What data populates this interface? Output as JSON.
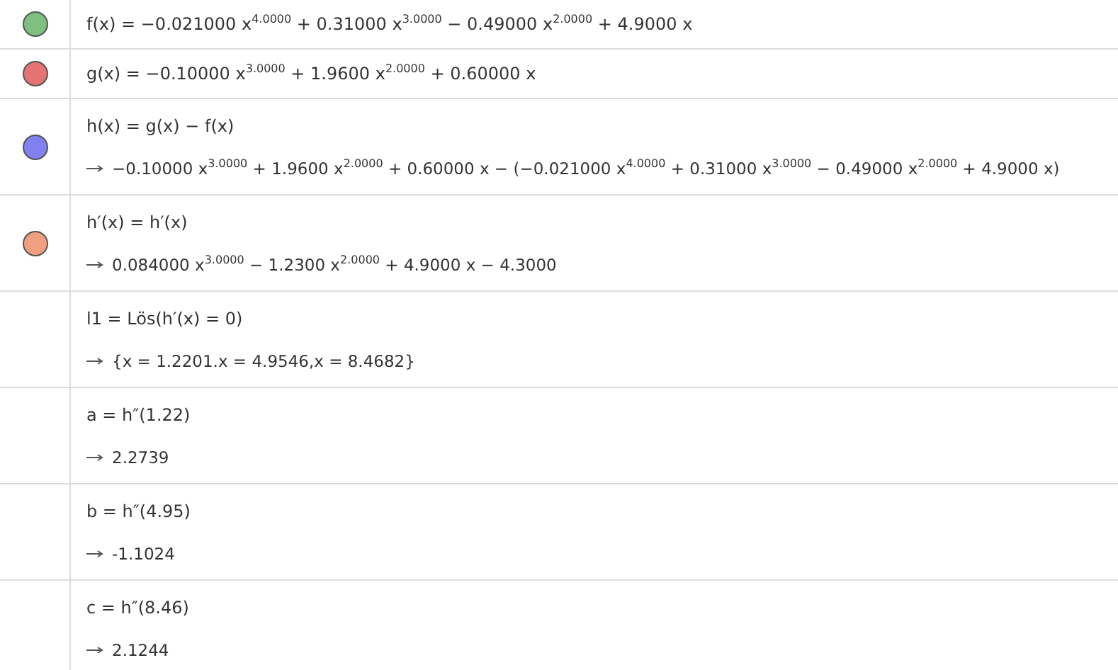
{
  "rows": [
    {
      "color": "#7fbf7f",
      "definition": "f(x) = −0.021000 x$^{4.0000}$ + 0.31000 x$^{3.0000}$ − 0.49000 x$^{2.0000}$ + 4.9000 x"
    },
    {
      "color": "#e57373",
      "definition": "g(x) = −0.10000 x$^{3.0000}$ + 1.9600 x$^{2.0000}$ + 0.60000 x"
    },
    {
      "color": "#8080ee",
      "definition": "h(x) = g(x) − f(x)",
      "output": "−0.10000 x$^{3.0000}$ + 1.9600 x$^{2.0000}$ + 0.60000 x − (−0.021000 x$^{4.0000}$ + 0.31000 x$^{3.0000}$ − 0.49000 x$^{2.0000}$ + 4.9000 x)"
    },
    {
      "color": "#f0a080",
      "definition": "h′(x) = h′(x)",
      "output": "0.084000 x$^{3.0000}$ − 1.2300 x$^{2.0000}$ + 4.9000 x − 4.3000"
    },
    {
      "definition": "l1 = Lös(h′(x) = 0)",
      "output": "{x = 1.2201.x = 4.9546,x = 8.4682}"
    },
    {
      "definition": "a = h″(1.22)",
      "output": "2.2739"
    },
    {
      "definition": "b = h″(4.95)",
      "output": "-1.1024"
    },
    {
      "definition": "c = h″(8.46)",
      "output": "2.1244"
    }
  ]
}
